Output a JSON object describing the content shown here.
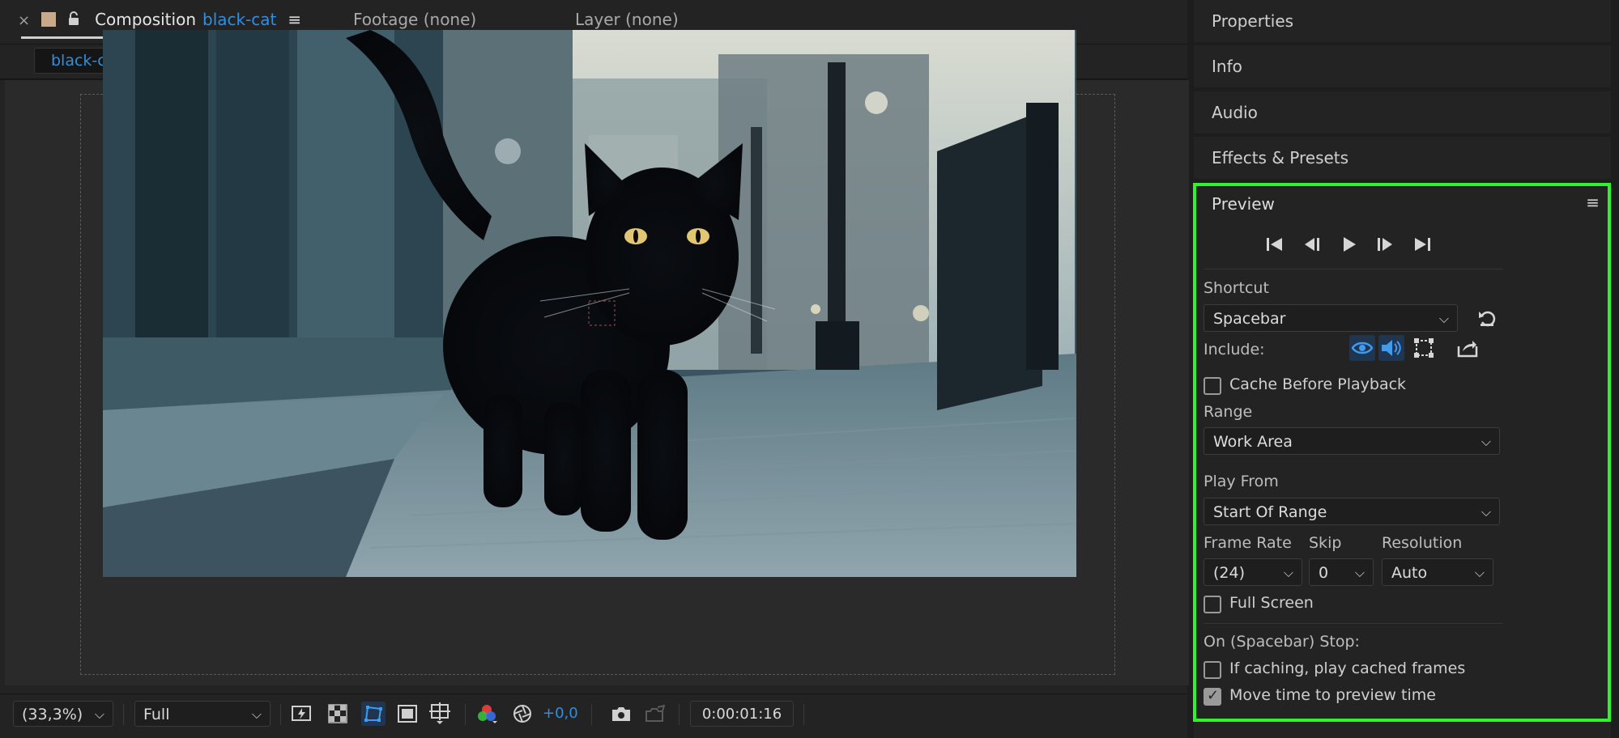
{
  "composition_panel": {
    "tab_close": "×",
    "tab_title": "Composition",
    "comp_name": "black-cat",
    "tab_menu": "≡",
    "footage_tab": "Footage (none)",
    "layer_tab": "Layer (none)",
    "breadcrumb": "black-cat"
  },
  "viewer_toolbar": {
    "zoom": "(33,3%)",
    "resolution": "Full",
    "exposure": "+0,0",
    "timecode": "0:00:01:16",
    "icons": [
      "fast-previews-icon",
      "transparency-grid-icon",
      "mask-path-icon",
      "region-of-interest-icon",
      "guides-icon",
      "channels-icon",
      "reset-exposure-icon",
      "snapshot-icon",
      "show-snapshot-icon"
    ]
  },
  "right_panels": {
    "collapsed": [
      "Properties",
      "Info",
      "Audio",
      "Effects & Presets"
    ]
  },
  "preview": {
    "title": "Preview",
    "menu": "≡",
    "transport": [
      "first-frame-icon",
      "previous-frame-icon",
      "play-icon",
      "next-frame-icon",
      "last-frame-icon"
    ],
    "shortcut_label": "Shortcut",
    "shortcut_value": "Spacebar",
    "include_label": "Include:",
    "cache_before_playback": "Cache Before Playback",
    "range_label": "Range",
    "range_value": "Work Area",
    "play_from_label": "Play From",
    "play_from_value": "Start Of Range",
    "frame_rate_label": "Frame Rate",
    "frame_rate_value": "(24)",
    "skip_label": "Skip",
    "skip_value": "0",
    "resolution_label": "Resolution",
    "resolution_value": "Auto",
    "full_screen": "Full Screen",
    "on_stop_label": "On (Spacebar) Stop:",
    "if_caching": "If caching, play cached frames",
    "move_time": "Move time to preview time",
    "cache_checked": false,
    "full_screen_checked": false,
    "if_caching_checked": false,
    "move_time_checked": true
  },
  "colors": {
    "accent_blue": "#2f8fe0",
    "highlight_green": "#2ff32f"
  }
}
